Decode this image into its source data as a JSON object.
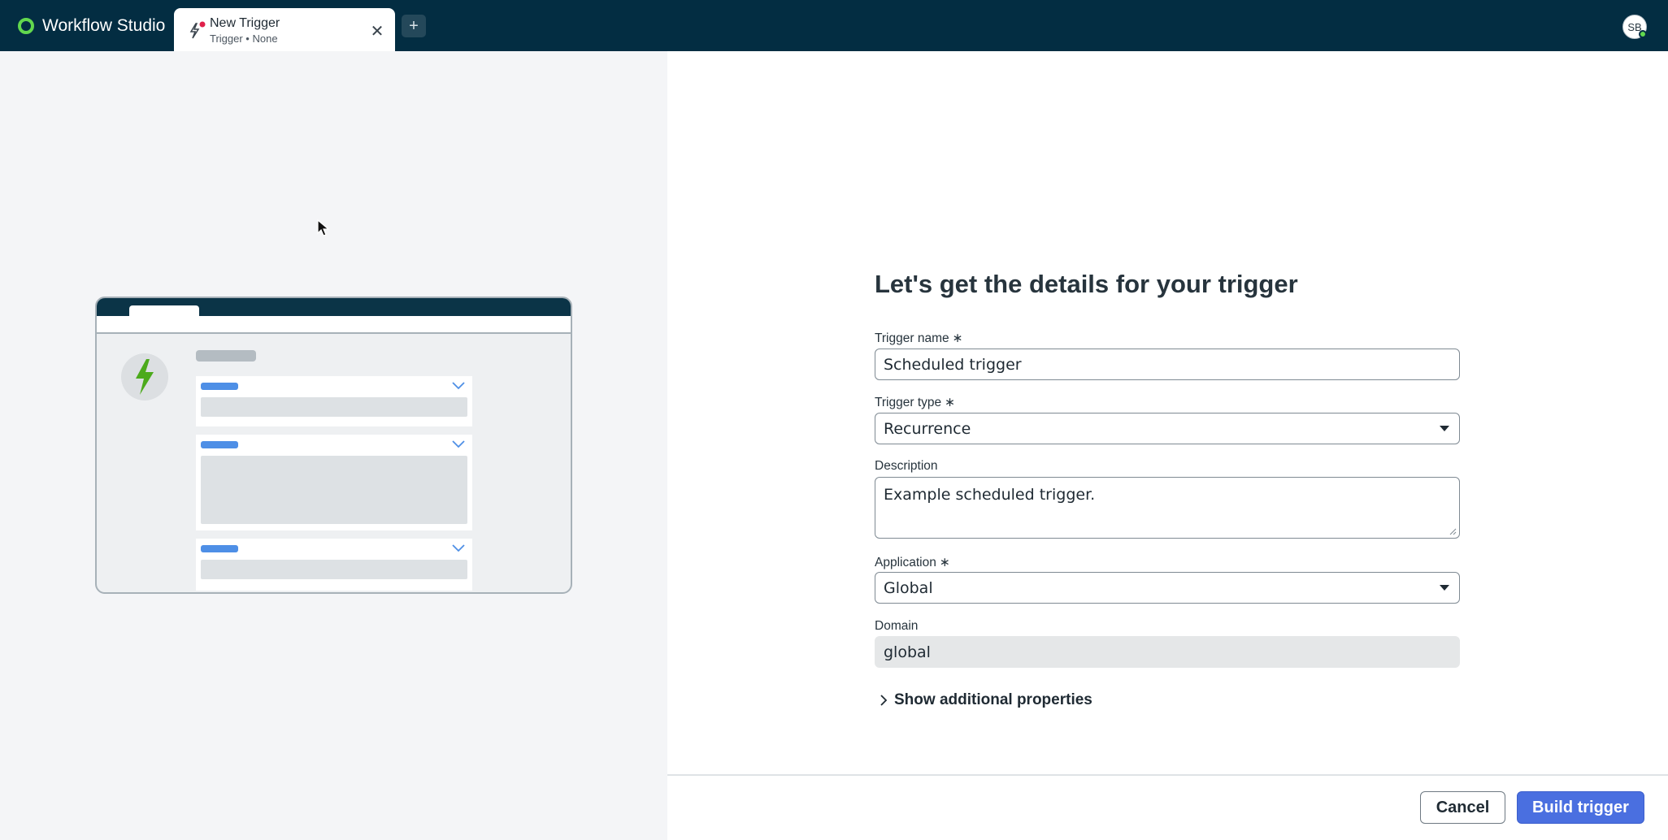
{
  "app": {
    "name": "Workflow Studio"
  },
  "tab": {
    "title": "New Trigger",
    "subtitle": "Trigger • None",
    "close_glyph": "✕"
  },
  "new_tab_glyph": "+",
  "user": {
    "initials": "SB"
  },
  "form": {
    "heading": "Let's get the details for your trigger",
    "required_marker": "∗",
    "trigger_name": {
      "label": "Trigger name",
      "value": "Scheduled trigger"
    },
    "trigger_type": {
      "label": "Trigger type",
      "value": "Recurrence"
    },
    "description": {
      "label": "Description",
      "value": "Example scheduled trigger."
    },
    "application": {
      "label": "Application",
      "value": "Global"
    },
    "domain": {
      "label": "Domain",
      "value": "global"
    },
    "show_more": "Show additional properties"
  },
  "footer": {
    "cancel": "Cancel",
    "build": "Build trigger"
  },
  "colors": {
    "topbar": "#032d42",
    "accent": "#4a6fe0",
    "brand_green": "#62d84e",
    "bolt_green": "#4caa1c"
  },
  "icons": [
    "workflow-logo-icon",
    "trigger-icon",
    "close-icon",
    "plus-icon",
    "cursor-icon",
    "lightning-icon",
    "chevron-down-icon",
    "chevron-right-icon",
    "caret-down-icon"
  ]
}
